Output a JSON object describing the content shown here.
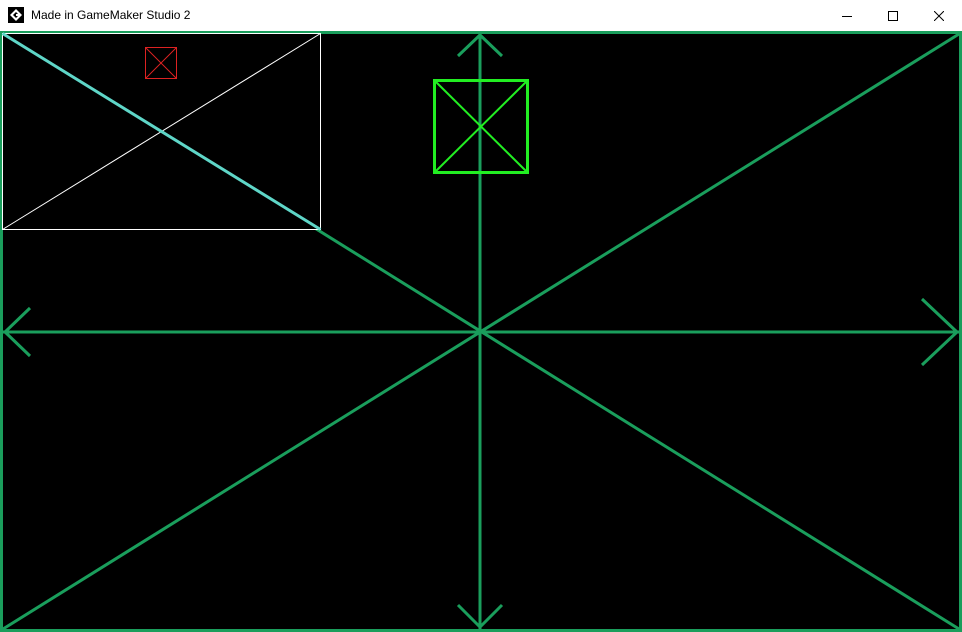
{
  "window": {
    "title": "Made in GameMaker Studio 2",
    "app_icon": "gamemaker-logo-icon",
    "controls": {
      "minimize_icon": "minimize-icon",
      "maximize_icon": "maximize-icon",
      "close_icon": "close-icon"
    }
  },
  "colors": {
    "background": "#000000",
    "frame": "#1a9e5c",
    "box_outline": "#22ee22",
    "viewport_outline": "#ffffff",
    "small_marker": "#dd2222",
    "diagonal_highlight": "#5fd6c8"
  }
}
